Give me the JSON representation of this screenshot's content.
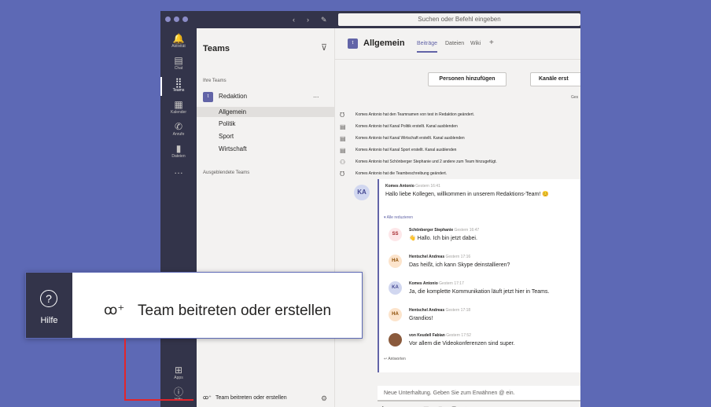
{
  "search": {
    "placeholder": "Suchen oder Befehl eingeben"
  },
  "rail": [
    {
      "icon": "bell-icon",
      "glyph": "🔔",
      "label": "Aktivität"
    },
    {
      "icon": "chat-icon",
      "glyph": "▤",
      "label": "Chat"
    },
    {
      "icon": "teams-icon",
      "glyph": "⣿",
      "label": "Teams"
    },
    {
      "icon": "calendar-icon",
      "glyph": "▦",
      "label": "Kalender"
    },
    {
      "icon": "phone-icon",
      "glyph": "✆",
      "label": "Anrufe"
    },
    {
      "icon": "files-icon",
      "glyph": "▮",
      "label": "Dateien"
    },
    {
      "icon": "more-icon",
      "glyph": "…",
      "label": ""
    },
    {
      "icon": "apps-icon",
      "glyph": "⊞",
      "label": "Apps"
    },
    {
      "icon": "help-icon",
      "glyph": "?",
      "label": "Hilfe"
    }
  ],
  "teams_pane": {
    "title": "Teams",
    "your_teams": "Ihre Teams",
    "team": {
      "avatar": "t",
      "name": "Redaktion",
      "more": "..."
    },
    "channels": [
      "Allgemein",
      "Politik",
      "Sport",
      "Wirtschaft"
    ],
    "hidden_teams": "Ausgeblendete Teams",
    "join_label": "Team beitreten oder erstellen"
  },
  "channel": {
    "avatar": "t",
    "name": "Allgemein",
    "tabs": [
      "Beiträge",
      "Dateien",
      "Wiki",
      "+"
    ],
    "add_people": "Personen hinzufügen",
    "create_channels": "Kanäle erst",
    "ges": "Ges"
  },
  "activity": [
    {
      "icon": "team-icon",
      "glyph": "℧",
      "text": "Komes Antonio hat den Teamnamen von test in Redaktion geändert."
    },
    {
      "icon": "channel-icon",
      "glyph": "▤",
      "text": "Komes Antonio hat Kanal Politik erstellt. Kanal ausblenden"
    },
    {
      "icon": "channel-icon",
      "glyph": "▤",
      "text": "Komes Antonio hat Kanal Wirtschaft erstellt. Kanal ausblenden"
    },
    {
      "icon": "channel-icon",
      "glyph": "▤",
      "text": "Komes Antonio hat Kanal Sport erstellt. Kanal ausblenden"
    },
    {
      "icon": "add-member-icon",
      "glyph": "⚇",
      "text": "Komes Antonio hat Schönberger Stephanie und 2 andere zum Team hinzugefügt."
    },
    {
      "icon": "team-icon",
      "glyph": "℧",
      "text": "Komes Antonio hat die Teambeschreibung geändert."
    }
  ],
  "main_post": {
    "avatar": "KA",
    "author": "Komes Antonio",
    "time": "Gestern 16:41",
    "text": "Hallo liebe Kollegen, willkommen in unserem Redaktions-Team! 😊"
  },
  "collapse_label": "Alle reduzieren",
  "replies": [
    {
      "avatar": "SS",
      "author": "Schönberger Stephanie",
      "time": "Gestern 16:47",
      "text": "👋 Hallo. Ich bin jetzt dabei."
    },
    {
      "avatar": "HA",
      "author": "Hentschel Andreas",
      "time": "Gestern 17:16",
      "text": "Das heißt, ich kann Skype deinstallieren?"
    },
    {
      "avatar": "KA",
      "author": "Komes Antonio",
      "time": "Gestern 17:17",
      "text": "Ja, die komplette Kommunikation läuft jetzt hier in Teams."
    },
    {
      "avatar": "HA",
      "author": "Hentschel Andreas",
      "time": "Gestern 17:18",
      "text": "Grandios!"
    },
    {
      "avatar": "",
      "author": "von Keudell Fabian",
      "time": "Gestern 17:52",
      "text": "Vor allem die Videokonferenzen sind super."
    }
  ],
  "reply_label": "Antworten",
  "compose_placeholder": "Neue Unterhaltung. Geben Sie zum Erwähnen @ ein.",
  "zoom": {
    "help_label": "Hilfe",
    "help_glyph": "?",
    "join_glyph": "ꝏ⁺",
    "join_label": "Team beitreten oder erstellen"
  },
  "colors": {
    "accent": "#6264a7",
    "rail": "#33344a",
    "background": "#5d69b5",
    "connector": "#e2252b"
  }
}
